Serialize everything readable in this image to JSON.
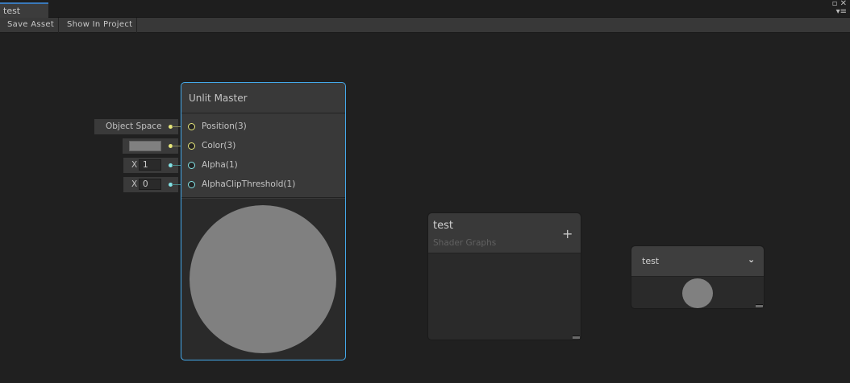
{
  "window": {
    "tab_title": "test"
  },
  "toolbar": {
    "save_asset": "Save Asset",
    "show_in_project": "Show In Project"
  },
  "master_node": {
    "title": "Unlit Master",
    "ports": [
      {
        "label": "Position(3)",
        "color": "#e8e87a"
      },
      {
        "label": "Color(3)",
        "color": "#e8e87a"
      },
      {
        "label": "Alpha(1)",
        "color": "#84e4e7"
      },
      {
        "label": "AlphaClipThreshold(1)",
        "color": "#84e4e7"
      }
    ],
    "inputs": {
      "position_space": "Object Space",
      "color_swatch": "#808080",
      "alpha_axis": "X",
      "alpha_value": "1",
      "clip_axis": "X",
      "clip_value": "0"
    }
  },
  "blackboard": {
    "title": "test",
    "subtitle": "Shader Graphs",
    "add_icon": "+"
  },
  "main_preview": {
    "title": "test",
    "collapse_icon": "chevron-down"
  }
}
